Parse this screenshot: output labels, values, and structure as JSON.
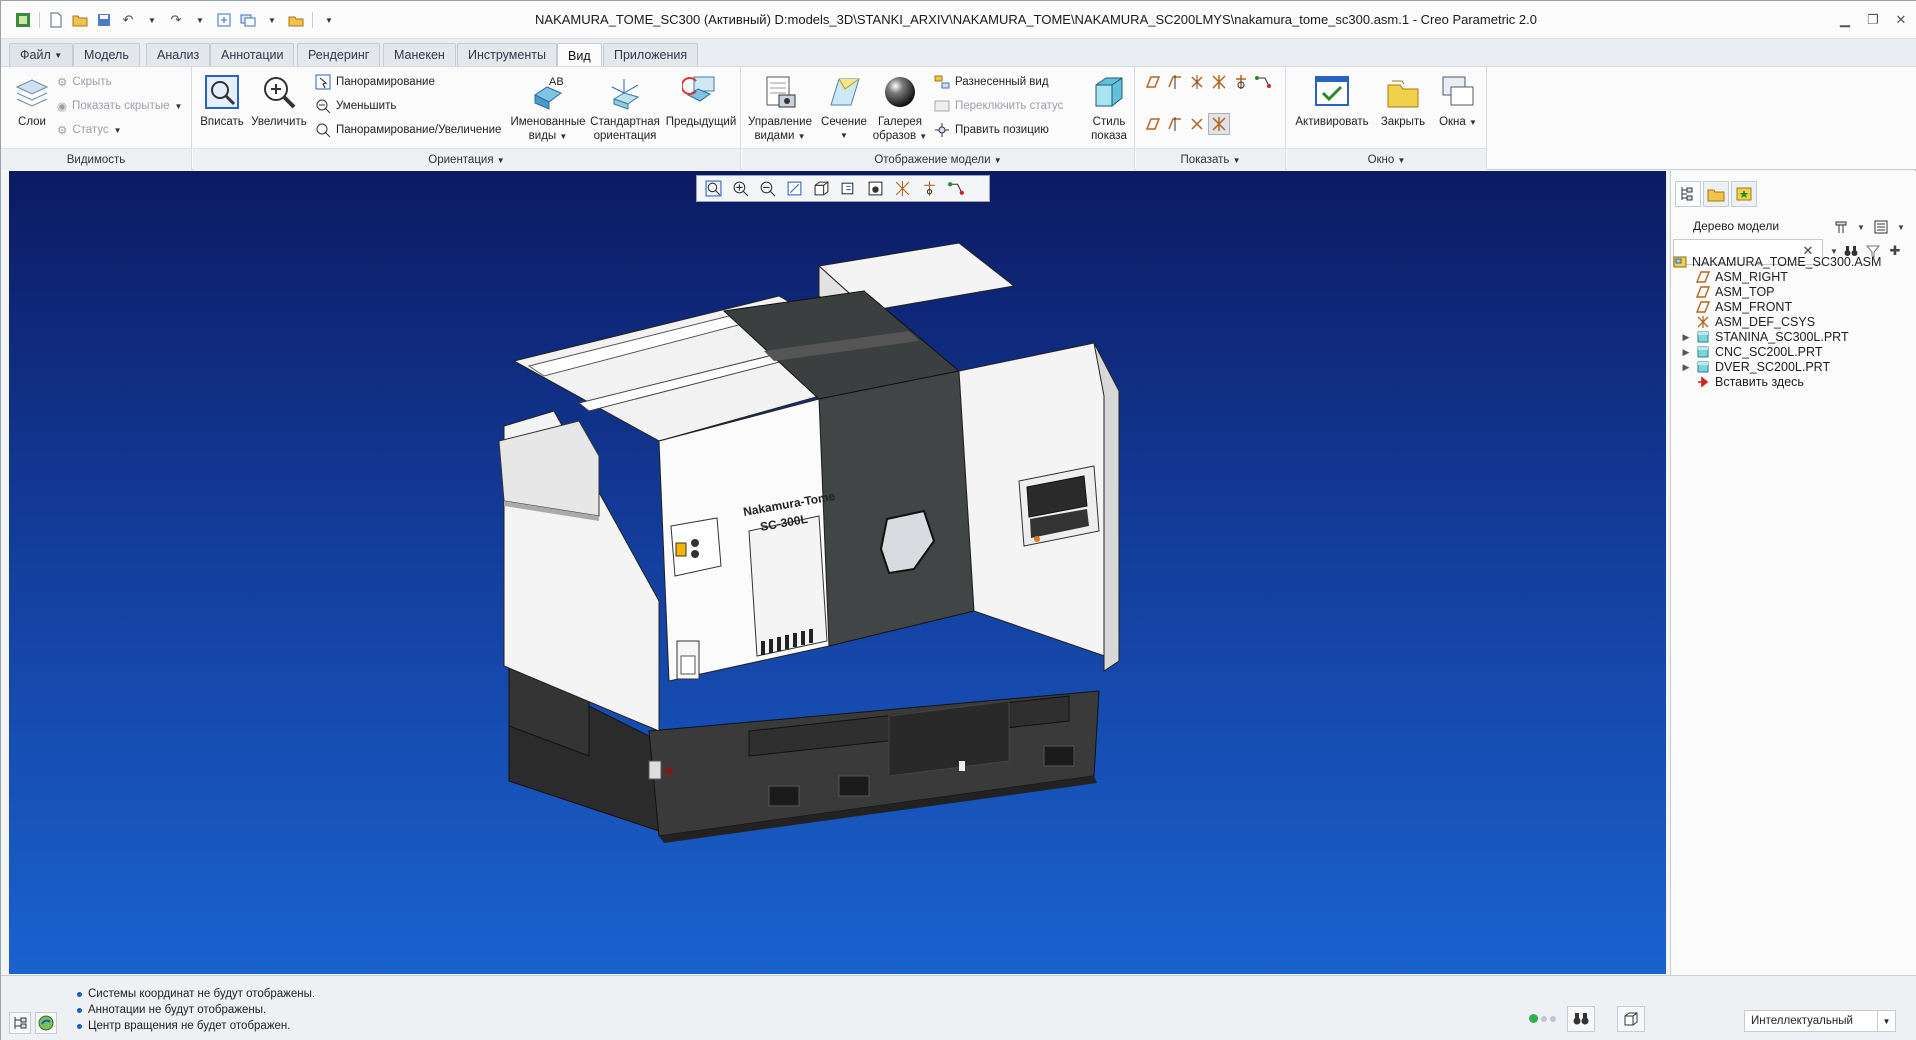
{
  "window": {
    "title": "NAKAMURA_TOME_SC300 (Активный) D:models_3D\\STANKI_ARXIV\\NAKAMURA_TOME\\NAKAMURA_SC200LMYS\\nakamura_tome_sc300.asm.1 - Creo Parametric 2.0"
  },
  "menu": {
    "tabs": [
      "Файл",
      "Модель",
      "Анализ",
      "Аннотации",
      "Рендеринг",
      "Манекен",
      "Инструменты",
      "Вид",
      "Приложения"
    ],
    "active_tab": "Вид"
  },
  "ribbon": {
    "visibility": {
      "label": "Видимость",
      "layers": "Слои",
      "hide": "Скрыть",
      "show_hidden": "Показать скрытые",
      "status": "Статус"
    },
    "orientation": {
      "label": "Ориентация",
      "refit": "Вписать",
      "zoom_in": "Увеличить",
      "pan": "Панорамирование",
      "zoom_out": "Уменьшить",
      "pan_zoom": "Панорамирование/Увеличение",
      "named_views_1": "Именованные",
      "named_views_2": "виды",
      "standard_1": "Стандартная",
      "standard_2": "ориентация",
      "previous": "Предыдущий"
    },
    "model_display": {
      "label": "Отображение модели",
      "manage_1": "Управление",
      "manage_2": "видами",
      "section": "Сечение",
      "gallery_1": "Галерея",
      "gallery_2": "образов",
      "exploded": "Разнесенный вид",
      "toggle_status": "Переключить статус",
      "edit_position": "Править позицию",
      "style_1": "Стиль",
      "style_2": "показа"
    },
    "show": {
      "label": "Показать"
    },
    "window": {
      "label": "Окно",
      "activate": "Активировать",
      "close": "Закрыть",
      "windows": "Окна"
    }
  },
  "viewport": {
    "machine_label_1": "Nakamura-Tome",
    "machine_label_2": "SC-300L"
  },
  "model_tree": {
    "title": "Дерево модели",
    "search_value": "",
    "items": [
      {
        "label": "NAKAMURA_TOME_SC300.ASM",
        "icon": "assembly-icon",
        "expandable": false
      },
      {
        "label": "ASM_RIGHT",
        "icon": "datum-plane-icon",
        "expandable": false
      },
      {
        "label": "ASM_TOP",
        "icon": "datum-plane-icon",
        "expandable": false
      },
      {
        "label": "ASM_FRONT",
        "icon": "datum-plane-icon",
        "expandable": false
      },
      {
        "label": "ASM_DEF_CSYS",
        "icon": "csys-icon",
        "expandable": false
      },
      {
        "label": "STANINA_SC300L.PRT",
        "icon": "part-icon",
        "expandable": true
      },
      {
        "label": "CNC_SC200L.PRT",
        "icon": "part-icon",
        "expandable": true
      },
      {
        "label": "DVER_SC200L.PRT",
        "icon": "part-icon",
        "expandable": true
      },
      {
        "label": "Вставить здесь",
        "icon": "insert-here-icon",
        "expandable": false
      }
    ]
  },
  "status_bar": {
    "messages": [
      "Системы координат не будут отображены.",
      "Аннотации не будут отображены.",
      "Центр вращения не будет отображен."
    ],
    "selection_filter": "Интеллектуальный"
  },
  "colors": {
    "viewport_top": "#0c1a63",
    "viewport_bottom": "#1a62cf",
    "accent": "#1b5cc7"
  }
}
